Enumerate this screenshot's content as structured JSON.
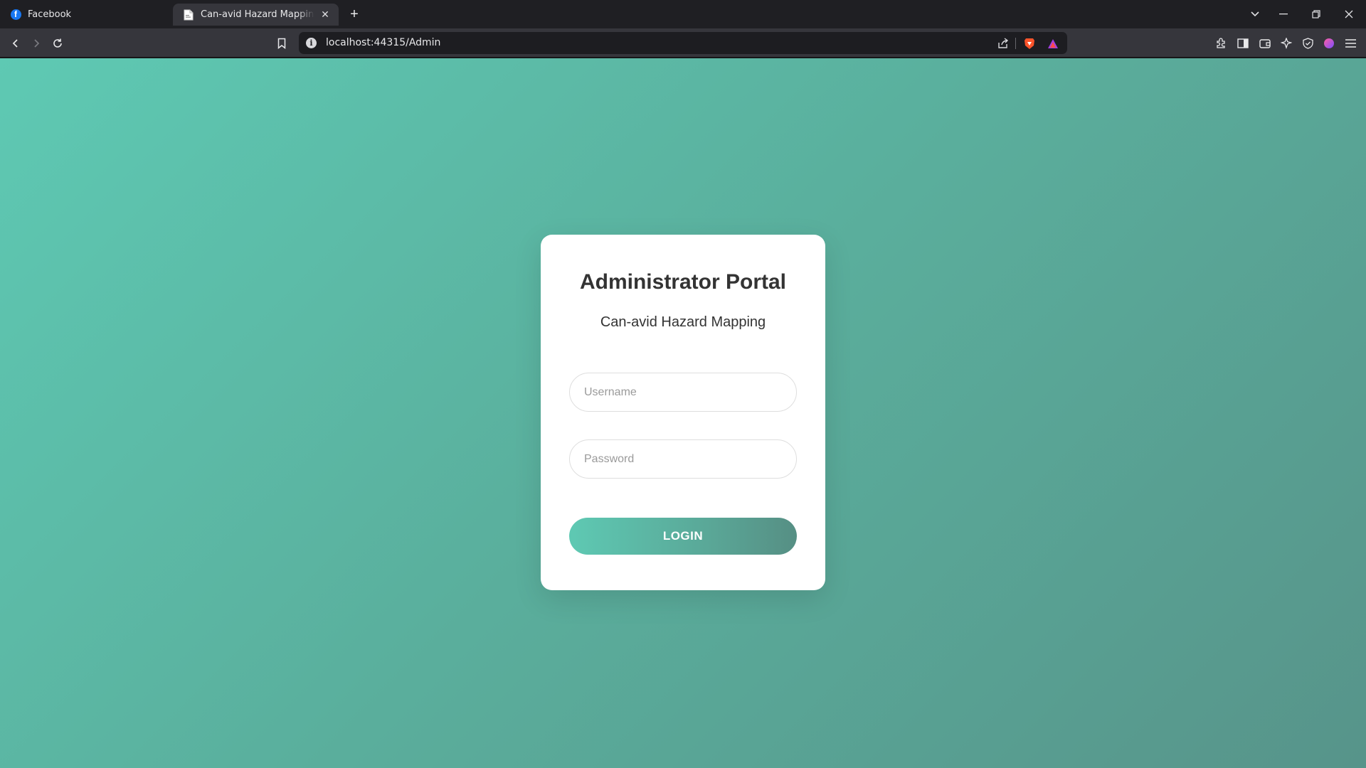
{
  "browser": {
    "tabs": [
      {
        "title": "Facebook",
        "favicon": "facebook-icon",
        "active": false
      },
      {
        "title": "Can-avid Hazard Mapping - Admin",
        "favicon": "document-icon",
        "active": true
      }
    ],
    "new_tab_label": "+",
    "address": "localhost:44315/Admin",
    "colors": {
      "tabstrip": "#1f1f23",
      "toolbar": "#36363c",
      "omnibox": "#1d1d21"
    }
  },
  "page": {
    "title": "Administrator Portal",
    "subtitle": "Can-avid Hazard Mapping",
    "username": {
      "placeholder": "Username",
      "value": ""
    },
    "password": {
      "placeholder": "Password",
      "value": ""
    },
    "login_label": "LOGIN",
    "colors": {
      "gradient_start": "#5ec9b3",
      "gradient_end": "#57948a",
      "card": "#ffffff",
      "text": "#333333"
    }
  }
}
